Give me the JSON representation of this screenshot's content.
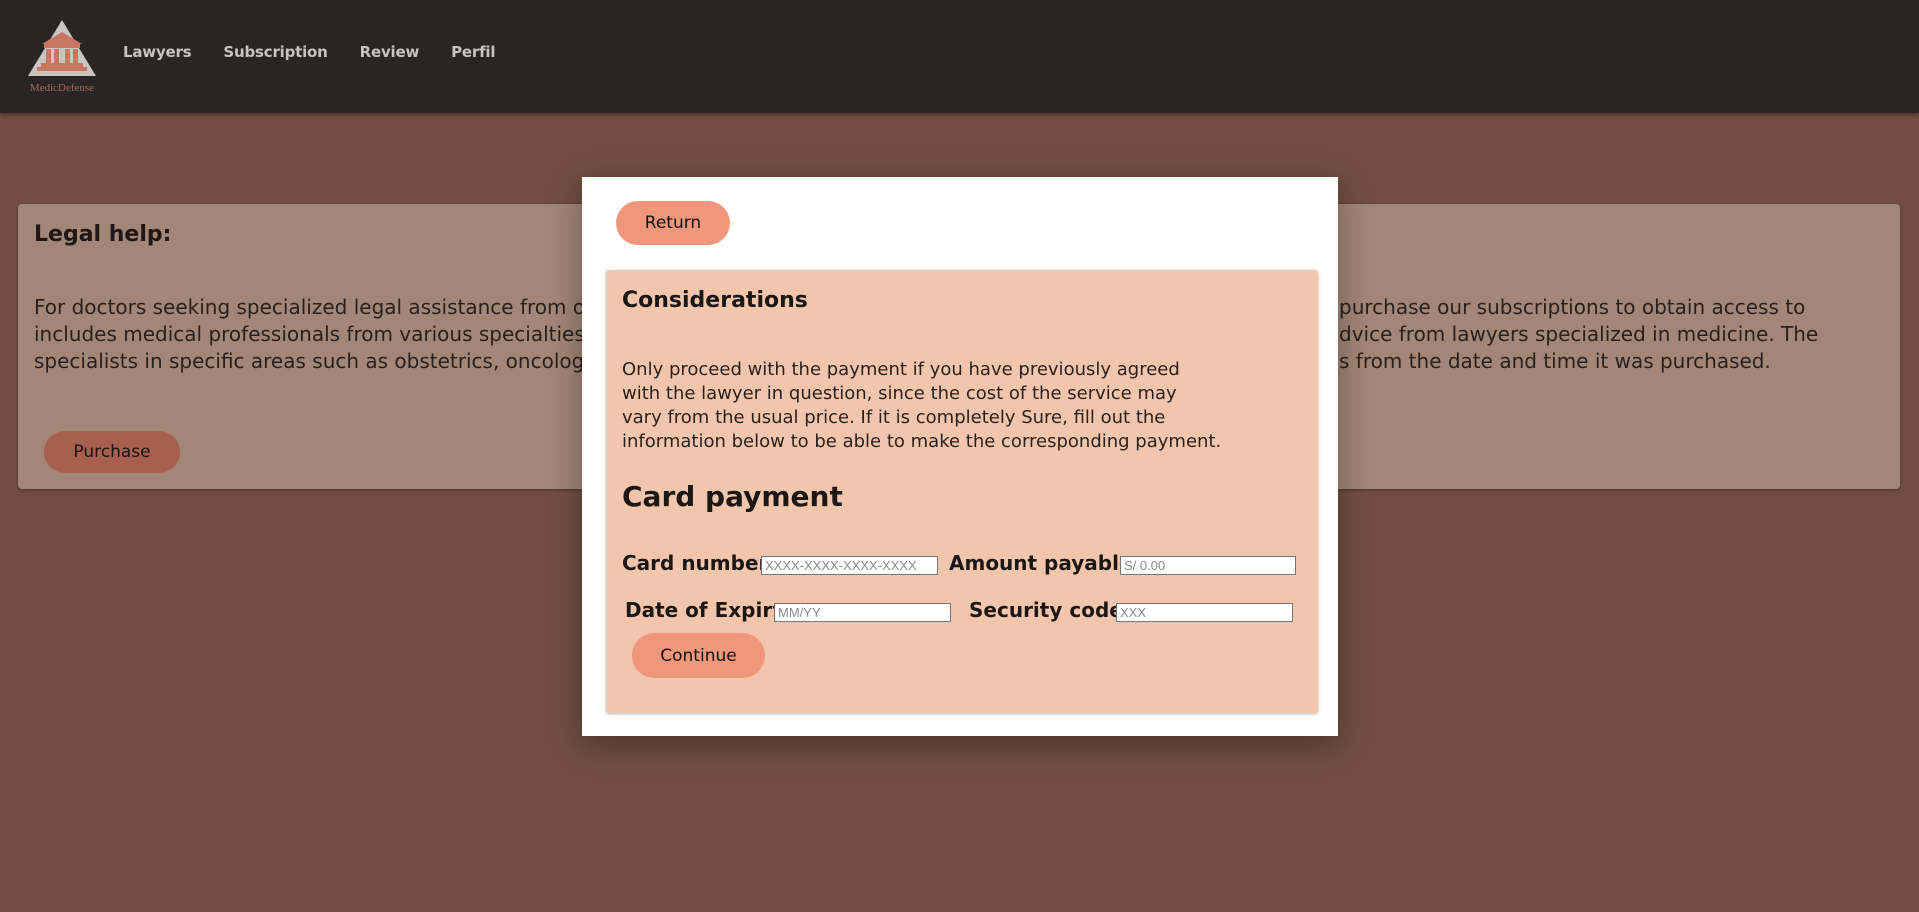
{
  "navbar": {
    "logo_text": "MedicDefense",
    "links": [
      "Lawyers",
      "Subscription",
      "Review",
      "Perfil"
    ]
  },
  "help_card": {
    "title": "Legal help:",
    "text_left": [
      "For doctors seeking specialized legal assistance from ou",
      "includes medical professionals from various specialties,",
      "specialists in specific areas such as obstetrics, oncology"
    ],
    "text_right": [
      "purchase our subscriptions to obtain access to",
      "dvice from lawyers specialized in medicine. The",
      "s from the date and time it was purchased."
    ],
    "purchase_label": "Purchase"
  },
  "modal": {
    "return_label": "Return",
    "considerations_title": "Considerations",
    "considerations_text": "Only proceed with the payment if you have previously agreed with the lawyer in question, since the cost of the service may vary from the usual price. If it is completely Sure, fill out the information below to be able to make the corresponding payment.",
    "payment_title": "Card payment",
    "card_number_label": "Card number:",
    "card_number_placeholder": "XXXX-XXXX-XXXX-XXXX",
    "amount_label": "Amount payable:",
    "amount_placeholder": "S/ 0.00",
    "expiry_label": "Date of Expiry:",
    "expiry_placeholder": "MM/YY",
    "security_label": "Security code:",
    "security_placeholder": "XXX",
    "continue_label": "Continue"
  },
  "colors": {
    "page_bg": "#714e41",
    "navbar_bg": "#292525",
    "accent_button": "#f0977b",
    "panel_bg": "#f1c6ad"
  }
}
